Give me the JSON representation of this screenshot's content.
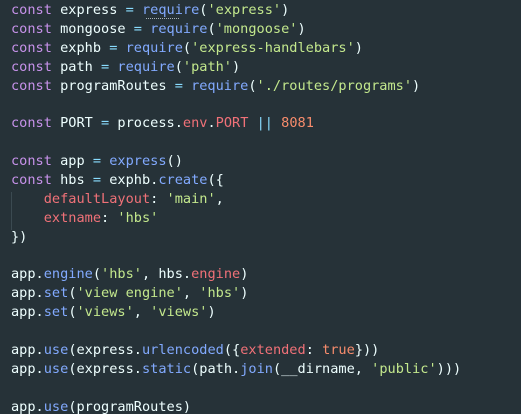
{
  "colors": {
    "background": "#263238",
    "keyword": "#c792ea",
    "variable": "#eeffff",
    "plain": "#eeffff",
    "function": "#82aaff",
    "string": "#c3e88d",
    "property": "#f07178",
    "number": "#f78c6c",
    "operator": "#89ddff",
    "punctuation": "#89ddff"
  },
  "editor": {
    "lines": [
      [
        {
          "t": "const",
          "c": "keyword"
        },
        {
          "t": " express ",
          "c": "plain"
        },
        {
          "t": "=",
          "c": "operator"
        },
        {
          "t": " ",
          "c": "plain"
        },
        {
          "t": "require",
          "c": "function"
        },
        {
          "t": "(",
          "c": "plain"
        },
        {
          "t": "'express'",
          "c": "string"
        },
        {
          "t": ")",
          "c": "plain"
        }
      ],
      [
        {
          "t": "const",
          "c": "keyword"
        },
        {
          "t": " mongoose ",
          "c": "plain"
        },
        {
          "t": "=",
          "c": "operator"
        },
        {
          "t": " ",
          "c": "plain"
        },
        {
          "t": "require",
          "c": "function"
        },
        {
          "t": "(",
          "c": "plain"
        },
        {
          "t": "'mongoose'",
          "c": "string"
        },
        {
          "t": ")",
          "c": "plain"
        }
      ],
      [
        {
          "t": "const",
          "c": "keyword"
        },
        {
          "t": " exphb ",
          "c": "plain"
        },
        {
          "t": "=",
          "c": "operator"
        },
        {
          "t": " ",
          "c": "plain"
        },
        {
          "t": "require",
          "c": "function"
        },
        {
          "t": "(",
          "c": "plain"
        },
        {
          "t": "'express-handlebars'",
          "c": "string"
        },
        {
          "t": ")",
          "c": "plain"
        }
      ],
      [
        {
          "t": "const",
          "c": "keyword"
        },
        {
          "t": " path ",
          "c": "plain"
        },
        {
          "t": "=",
          "c": "operator"
        },
        {
          "t": " ",
          "c": "plain"
        },
        {
          "t": "require",
          "c": "function"
        },
        {
          "t": "(",
          "c": "plain"
        },
        {
          "t": "'path'",
          "c": "string"
        },
        {
          "t": ")",
          "c": "plain"
        }
      ],
      [
        {
          "t": "const",
          "c": "keyword"
        },
        {
          "t": " programRoutes ",
          "c": "plain"
        },
        {
          "t": "=",
          "c": "operator"
        },
        {
          "t": " ",
          "c": "plain"
        },
        {
          "t": "require",
          "c": "function"
        },
        {
          "t": "(",
          "c": "plain"
        },
        {
          "t": "'./routes/programs'",
          "c": "string"
        },
        {
          "t": ")",
          "c": "plain"
        }
      ],
      [],
      [
        {
          "t": "const",
          "c": "keyword"
        },
        {
          "t": " PORT ",
          "c": "plain"
        },
        {
          "t": "=",
          "c": "operator"
        },
        {
          "t": " process.",
          "c": "plain"
        },
        {
          "t": "env",
          "c": "property"
        },
        {
          "t": ".",
          "c": "plain"
        },
        {
          "t": "PORT",
          "c": "property"
        },
        {
          "t": " ",
          "c": "plain"
        },
        {
          "t": "||",
          "c": "operator"
        },
        {
          "t": " ",
          "c": "plain"
        },
        {
          "t": "8081",
          "c": "number"
        }
      ],
      [],
      [
        {
          "t": "const",
          "c": "keyword"
        },
        {
          "t": " app ",
          "c": "plain"
        },
        {
          "t": "=",
          "c": "operator"
        },
        {
          "t": " ",
          "c": "plain"
        },
        {
          "t": "express",
          "c": "function"
        },
        {
          "t": "()",
          "c": "plain"
        }
      ],
      [
        {
          "t": "const",
          "c": "keyword"
        },
        {
          "t": " hbs ",
          "c": "plain"
        },
        {
          "t": "=",
          "c": "operator"
        },
        {
          "t": " exphb.",
          "c": "plain"
        },
        {
          "t": "create",
          "c": "function"
        },
        {
          "t": "({",
          "c": "plain"
        }
      ],
      [
        {
          "t": "    ",
          "c": "plain"
        },
        {
          "t": "defaultLayout",
          "c": "property"
        },
        {
          "t": ": ",
          "c": "plain"
        },
        {
          "t": "'main'",
          "c": "string"
        },
        {
          "t": ",",
          "c": "plain"
        }
      ],
      [
        {
          "t": "    ",
          "c": "plain"
        },
        {
          "t": "extname",
          "c": "property"
        },
        {
          "t": ": ",
          "c": "plain"
        },
        {
          "t": "'hbs'",
          "c": "string"
        }
      ],
      [
        {
          "t": "})",
          "c": "plain"
        }
      ],
      [],
      [
        {
          "t": "app.",
          "c": "plain"
        },
        {
          "t": "engine",
          "c": "function"
        },
        {
          "t": "(",
          "c": "plain"
        },
        {
          "t": "'hbs'",
          "c": "string"
        },
        {
          "t": ", hbs.",
          "c": "plain"
        },
        {
          "t": "engine",
          "c": "property"
        },
        {
          "t": ")",
          "c": "plain"
        }
      ],
      [
        {
          "t": "app.",
          "c": "plain"
        },
        {
          "t": "set",
          "c": "function"
        },
        {
          "t": "(",
          "c": "plain"
        },
        {
          "t": "'view engine'",
          "c": "string"
        },
        {
          "t": ", ",
          "c": "plain"
        },
        {
          "t": "'hbs'",
          "c": "string"
        },
        {
          "t": ")",
          "c": "plain"
        }
      ],
      [
        {
          "t": "app.",
          "c": "plain"
        },
        {
          "t": "set",
          "c": "function"
        },
        {
          "t": "(",
          "c": "plain"
        },
        {
          "t": "'views'",
          "c": "string"
        },
        {
          "t": ", ",
          "c": "plain"
        },
        {
          "t": "'views'",
          "c": "string"
        },
        {
          "t": ")",
          "c": "plain"
        }
      ],
      [],
      [
        {
          "t": "app.",
          "c": "plain"
        },
        {
          "t": "use",
          "c": "function"
        },
        {
          "t": "(express.",
          "c": "plain"
        },
        {
          "t": "urlencoded",
          "c": "function"
        },
        {
          "t": "({",
          "c": "plain"
        },
        {
          "t": "extended",
          "c": "property"
        },
        {
          "t": ": ",
          "c": "plain"
        },
        {
          "t": "true",
          "c": "number"
        },
        {
          "t": "}))",
          "c": "plain"
        }
      ],
      [
        {
          "t": "app.",
          "c": "plain"
        },
        {
          "t": "use",
          "c": "function"
        },
        {
          "t": "(express.",
          "c": "plain"
        },
        {
          "t": "static",
          "c": "function"
        },
        {
          "t": "(path.",
          "c": "plain"
        },
        {
          "t": "join",
          "c": "function"
        },
        {
          "t": "(__dirname, ",
          "c": "plain"
        },
        {
          "t": "'public'",
          "c": "string"
        },
        {
          "t": ")))",
          "c": "plain"
        }
      ],
      [],
      [
        {
          "t": "app.",
          "c": "plain"
        },
        {
          "t": "use",
          "c": "function"
        },
        {
          "t": "(programRoutes)",
          "c": "plain"
        }
      ]
    ]
  }
}
